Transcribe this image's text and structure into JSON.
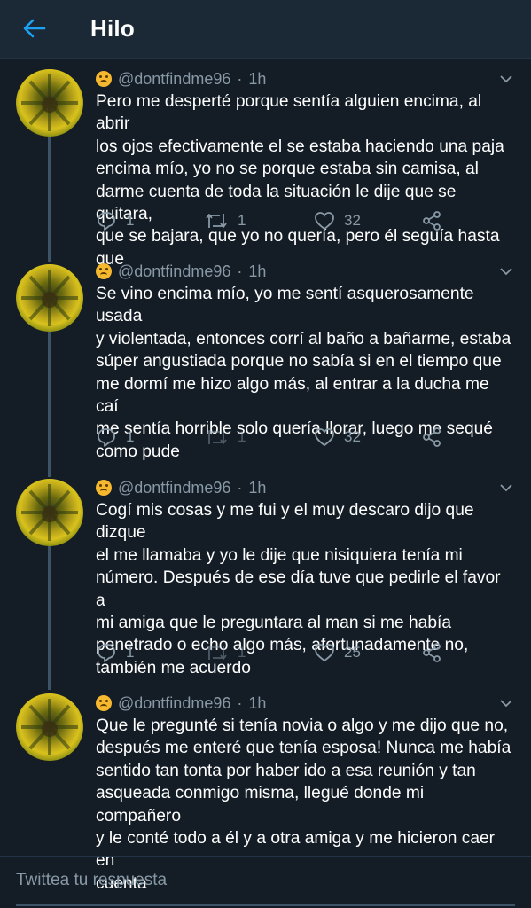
{
  "header": {
    "title": "Hilo",
    "back_icon": "arrow-left-icon",
    "accent": "#1da1f2"
  },
  "tweets": [
    {
      "handle": "@dontfindme96",
      "sep": "·",
      "time": "1h",
      "text": "Pero me desperté porque sentía alguien encima, al abrir\nlos ojos efectivamente el se estaba haciendo una paja\nencima mío, yo no se porque estaba sin camisa, al\ndarme cuenta de toda la situación le dije que se quitara,\nque se bajara, que yo no quería, pero él seguía hasta que",
      "replies": "1",
      "retweets": "1",
      "likes": "32"
    },
    {
      "handle": "@dontfindme96",
      "sep": "·",
      "time": "1h",
      "text": "Se vino encima mío, yo me sentí asquerosamente usada\ny violentada, entonces corrí al baño a bañarme, estaba\nsúper angustiada porque no sabía si en el tiempo que\nme dormí me hizo algo más, al entrar a la ducha me caí\nme sentía horrible solo quería llorar, luego me sequé\ncomo pude",
      "replies": "1",
      "retweets": "1",
      "likes": "32"
    },
    {
      "handle": "@dontfindme96",
      "sep": "·",
      "time": "1h",
      "text": "Cogí mis cosas y me fui y el muy descaro dijo que dizque\nel me llamaba y yo le dije que nisiquiera tenía mi\nnúmero. Después de ese día tuve que pedirle el favor a\nmi amiga que le preguntara al man si me había\npenetrado o echo algo más, afortunadamente no,\ntambién me acuerdo",
      "replies": "1",
      "retweets": "1",
      "likes": "25"
    },
    {
      "handle": "@dontfindme96",
      "sep": "·",
      "time": "1h",
      "text": "Que le pregunté si tenía novia o algo y me dijo que no,\ndespués me enteré que tenía esposa! Nunca me había\nsentido tan tonta por haber ido a esa reunión y tan\nasqueada conmigo misma, llegué donde mi compañero\ny le conté todo a él y a otra amiga y me hicieron caer en\ncuenta"
    }
  ],
  "reply_bar": {
    "placeholder": "Twittea tu respuesta"
  },
  "icons": {
    "reply": "reply-icon",
    "retweet": "retweet-icon",
    "like": "heart-icon",
    "share": "share-icon",
    "menu": "chevron-down-icon",
    "emoji": "upside-down-face-icon"
  }
}
